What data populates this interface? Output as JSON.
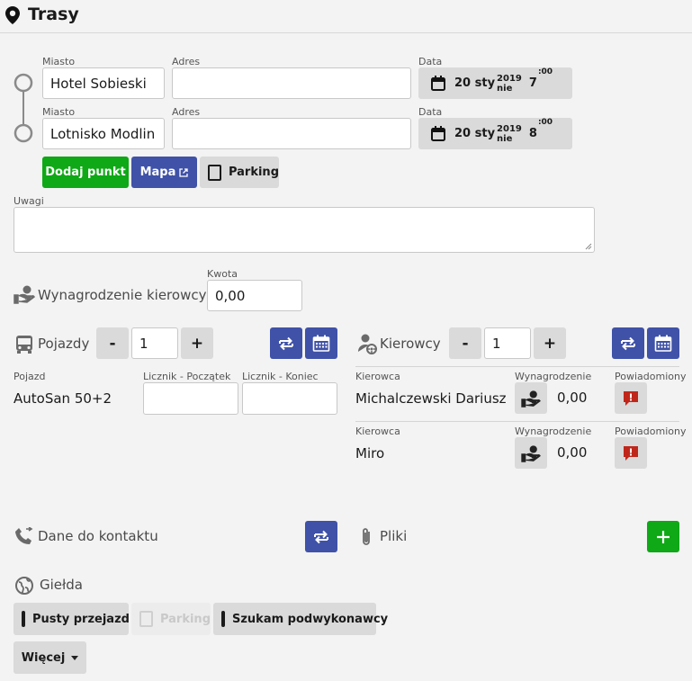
{
  "header": {
    "title": "Trasy"
  },
  "route": {
    "points": [
      {
        "city_label": "Miasto",
        "city": "Hotel Sobieski",
        "address_label": "Adres",
        "address": "",
        "date_label": "Data",
        "day": "20 sty",
        "year": "2019",
        "weekday": "nie",
        "hour": "7",
        "minute": ":00"
      },
      {
        "city_label": "Miasto",
        "city": "Lotnisko Modlin",
        "address_label": "Adres",
        "address": "",
        "date_label": "Data",
        "day": "20 sty",
        "year": "2019",
        "weekday": "nie",
        "hour": "8",
        "minute": ":00"
      }
    ],
    "add_point_label": "Dodaj punkt",
    "map_label": "Mapa",
    "parking_label": "Parking"
  },
  "notes": {
    "label": "Uwagi",
    "value": ""
  },
  "driver_pay": {
    "title": "Wynagrodzenie kierowcy",
    "amount_label": "Kwota",
    "amount": "0,00"
  },
  "vehicles": {
    "title": "Pojazdy",
    "minus": "-",
    "count": "1",
    "plus": "+",
    "col_vehicle": "Pojazd",
    "col_start": "Licznik - Początek",
    "col_end": "Licznik - Koniec",
    "rows": [
      {
        "name": "AutoSan 50+2",
        "start": "",
        "end": ""
      }
    ]
  },
  "drivers": {
    "title": "Kierowcy",
    "minus": "-",
    "count": "1",
    "plus": "+",
    "col_driver": "Kierowca",
    "col_pay": "Wynagrodzenie",
    "col_notified": "Powiadomiony",
    "rows": [
      {
        "name": "Michalczewski Dariusz",
        "pay": "0,00"
      },
      {
        "name": "Miro",
        "pay": "0,00"
      }
    ]
  },
  "contact": {
    "title": "Dane do kontaktu"
  },
  "files": {
    "title": "Pliki"
  },
  "exchange": {
    "title": "Giełda",
    "empty_run_label": "Pusty przejazd",
    "parking_label": "Parking",
    "subcontractor_label": "Szukam podwykonawcy",
    "more_label": "Więcej"
  },
  "colors": {
    "green": "#0fa816",
    "blue": "#3f52a8",
    "alert_red": "#c0271b",
    "gray_button": "#dadada"
  }
}
